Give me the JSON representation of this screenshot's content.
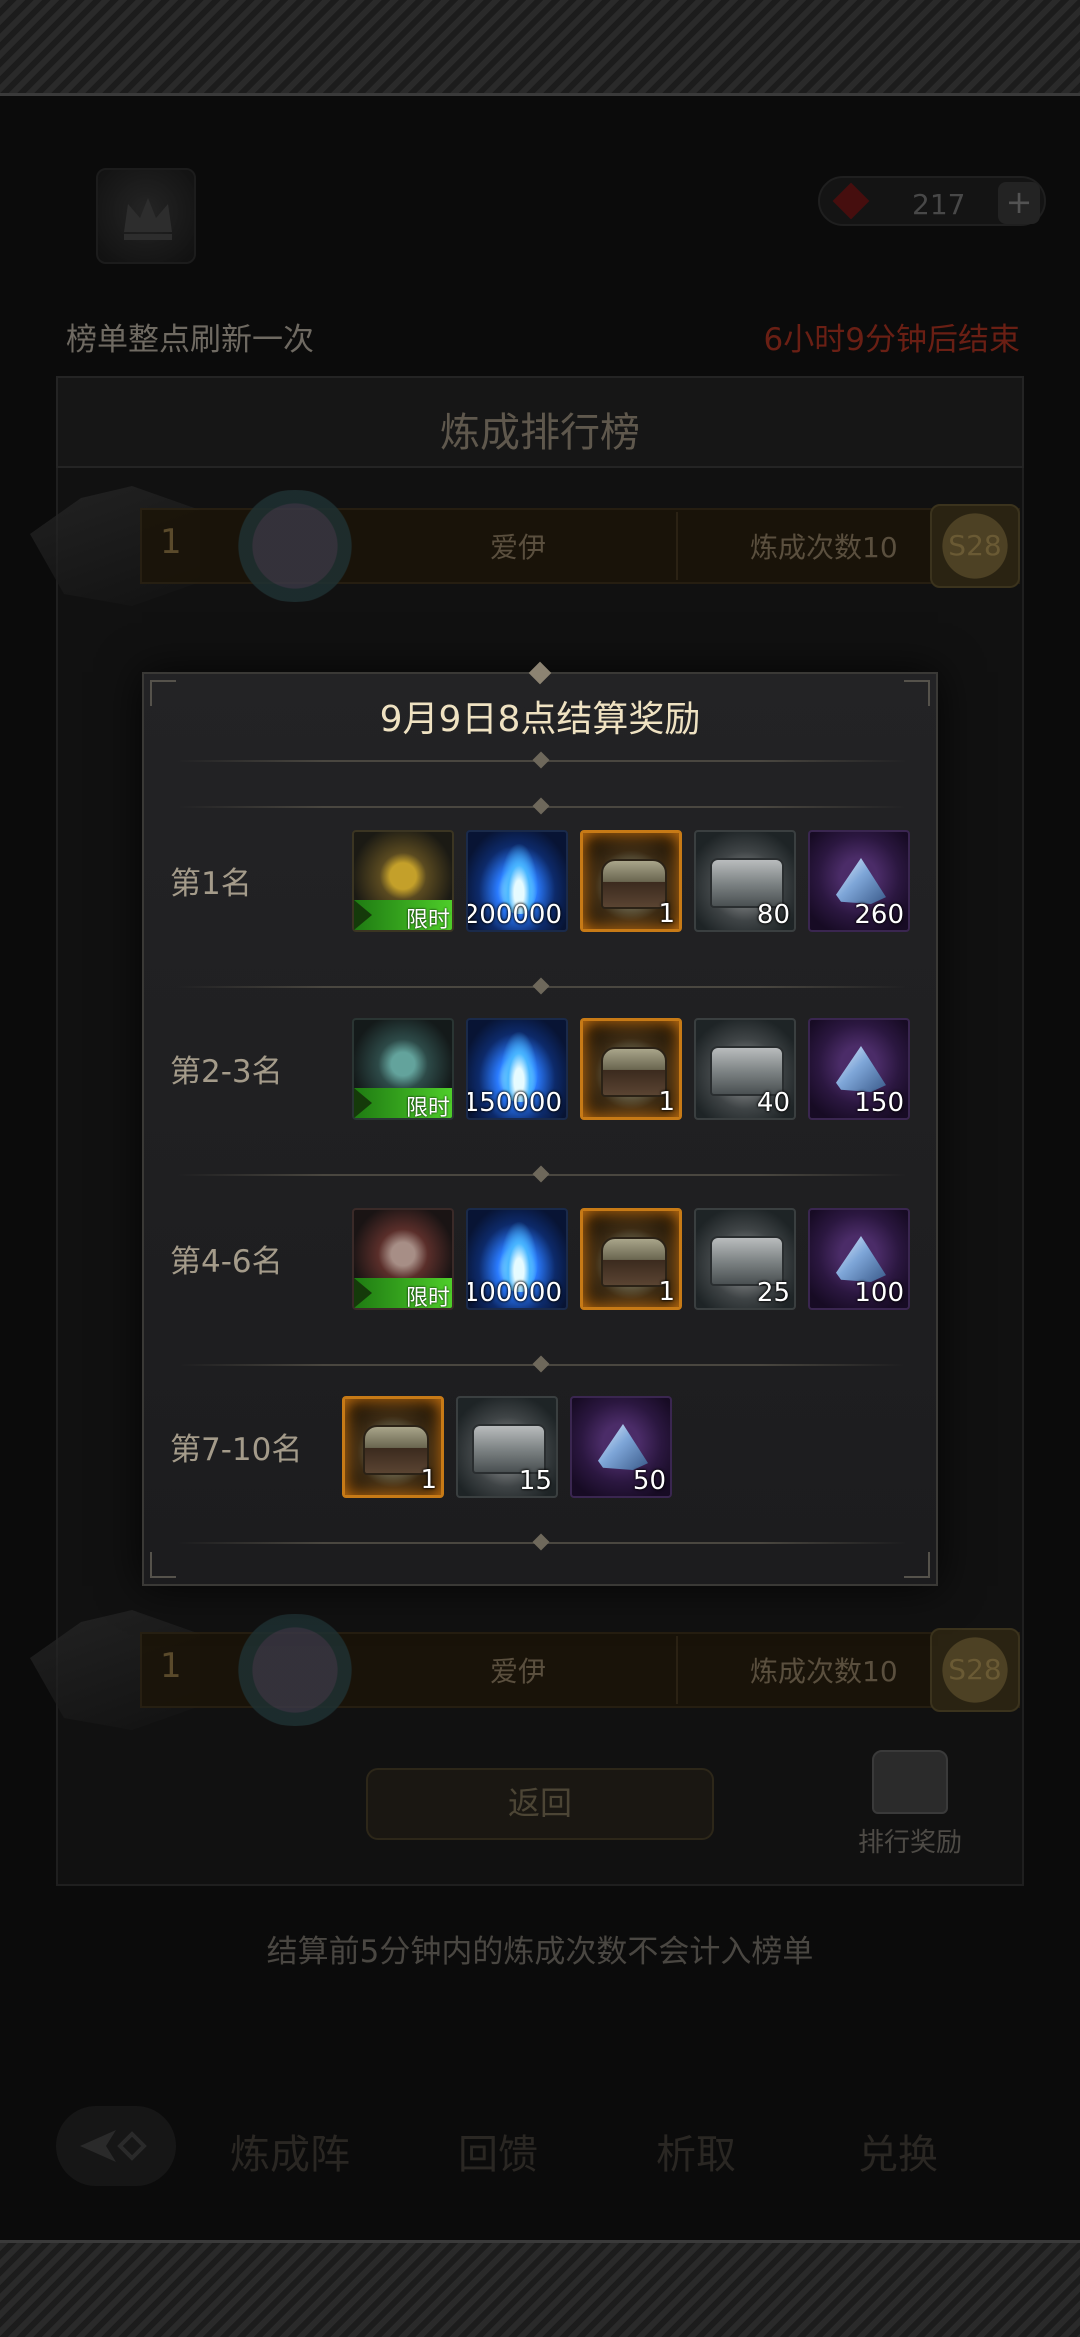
{
  "header": {
    "currency_value": "217",
    "currency_plus": "+",
    "refresh_note": "榜单整点刷新一次",
    "countdown": "6小时9分钟后结束"
  },
  "ranking": {
    "title": "炼成排行榜",
    "rows": [
      {
        "rank": "1",
        "name": "爱伊",
        "count": "炼成次数10",
        "badge": "S28"
      },
      {
        "rank": "1",
        "name": "爱伊",
        "count": "炼成次数10",
        "badge": "S28"
      }
    ],
    "back_label": "返回",
    "reward_entry_label": "排行奖励",
    "settle_note": "结算前5分钟内的炼成次数不会计入榜单"
  },
  "bottom_nav": {
    "tabs": [
      "炼成阵",
      "回馈",
      "析取",
      "兑换"
    ]
  },
  "dialog": {
    "title": "9月9日8点结算奖励",
    "limited_tag": "限时",
    "tiers": [
      {
        "label": "第1名",
        "items": [
          {
            "type": "beast-gold",
            "qty": "",
            "limited": true
          },
          {
            "type": "flame",
            "qty": "200000"
          },
          {
            "type": "chest-gold",
            "qty": "1"
          },
          {
            "type": "chest-silver",
            "qty": "80"
          },
          {
            "type": "crystal",
            "qty": "260"
          }
        ]
      },
      {
        "label": "第2-3名",
        "items": [
          {
            "type": "beast-teal",
            "qty": "",
            "limited": true
          },
          {
            "type": "flame",
            "qty": "150000"
          },
          {
            "type": "chest-gold",
            "qty": "1"
          },
          {
            "type": "chest-silver",
            "qty": "40"
          },
          {
            "type": "crystal",
            "qty": "150"
          }
        ]
      },
      {
        "label": "第4-6名",
        "items": [
          {
            "type": "beast-red",
            "qty": "",
            "limited": true
          },
          {
            "type": "flame",
            "qty": "100000"
          },
          {
            "type": "chest-gold",
            "qty": "1"
          },
          {
            "type": "chest-silver",
            "qty": "25"
          },
          {
            "type": "crystal",
            "qty": "100"
          }
        ]
      },
      {
        "label": "第7-10名",
        "items": [
          {
            "type": "chest-gold",
            "qty": "1"
          },
          {
            "type": "chest-silver",
            "qty": "15"
          },
          {
            "type": "crystal",
            "qty": "50"
          }
        ]
      }
    ]
  }
}
